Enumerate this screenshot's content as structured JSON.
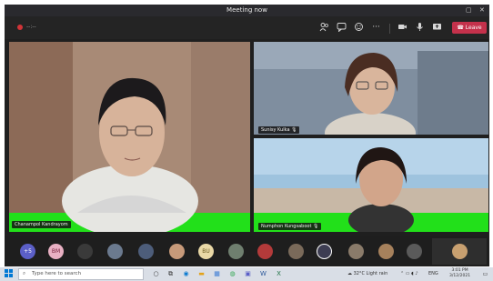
{
  "window": {
    "title": "Meeting now",
    "restore_glyph": "▢",
    "close_glyph": "✕"
  },
  "toolbar": {
    "timer": "--:--",
    "leave_label": "Leave",
    "more_glyph": "···",
    "icons": [
      "people-icon",
      "chat-icon",
      "reactions-icon",
      "more-icon",
      "camera-icon",
      "mic-icon",
      "share-icon"
    ],
    "leave_color": "#c4314b"
  },
  "video": {
    "participants": [
      {
        "name": "Chanampol Kandrayom",
        "label": "Chanampol Kandrayom",
        "muted": false
      },
      {
        "name": "Sunisy Kulka",
        "label": "Sunisy Kulka",
        "muted": true
      },
      {
        "name": "Numphon Kungsaboot",
        "label": "Numphon Kungsaboot",
        "muted": true
      }
    ],
    "mic_off_glyph": "🎙"
  },
  "roster": {
    "avatars": [
      {
        "initials": "+5",
        "color": "#5b5fc7"
      },
      {
        "initials": "BM",
        "color": "#e8b0c3"
      },
      {
        "initials": "",
        "color": "#3a3a3a"
      },
      {
        "initials": "",
        "color": "#6b7a8f"
      },
      {
        "initials": "",
        "color": "#4d5d7a"
      },
      {
        "initials": "",
        "color": "#c79a7a"
      },
      {
        "initials": "BU",
        "color": "#e9d8a6"
      },
      {
        "initials": "",
        "color": "#6f7f6f"
      },
      {
        "initials": "",
        "color": "#b33a3a"
      },
      {
        "initials": "",
        "color": "#7a6a5a"
      },
      {
        "initials": "",
        "color": "#3d3d52"
      },
      {
        "initials": "",
        "color": "#8a7b6a"
      },
      {
        "initials": "",
        "color": "#a6815c"
      },
      {
        "initials": "",
        "color": "#5a5a5a"
      }
    ]
  },
  "taskbar": {
    "search_placeholder": "Type here to search",
    "weather": "32°C Light rain",
    "language": "ENG",
    "time": "3:01 PM",
    "date": "3/12/2021",
    "apps": [
      "windows-icon",
      "search-icon",
      "task-view-icon",
      "edge-icon",
      "file-explorer-icon",
      "store-icon",
      "chrome-icon",
      "teams-icon",
      "word-icon",
      "excel-icon"
    ]
  }
}
